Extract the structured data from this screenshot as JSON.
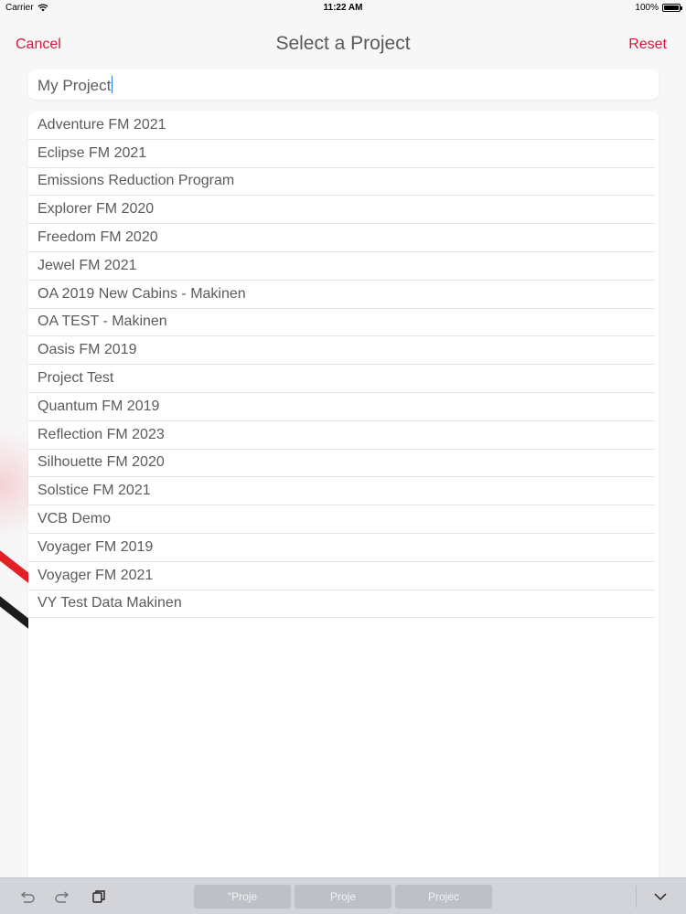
{
  "status_bar": {
    "carrier": "Carrier",
    "time": "11:22 AM",
    "battery": "100%"
  },
  "nav": {
    "cancel_label": "Cancel",
    "title": "Select a Project",
    "reset_label": "Reset"
  },
  "search": {
    "value": "My Project"
  },
  "projects": [
    "Adventure FM 2021",
    "Eclipse FM 2021",
    "Emissions Reduction Program",
    "Explorer FM 2020",
    "Freedom FM 2020",
    "Jewel FM 2021",
    "OA 2019 New Cabins - Makinen",
    "OA TEST - Makinen",
    "Oasis FM 2019",
    "Project Test",
    "Quantum FM 2019",
    "Reflection FM 2023",
    "Silhouette FM 2020",
    "Solstice FM 2021",
    "VCB Demo",
    "Voyager FM 2019",
    "Voyager FM 2021",
    "VY Test Data Makinen"
  ],
  "keyboard_bar": {
    "suggestions": [
      "\"Proje",
      "Proje",
      "Projec"
    ]
  },
  "colors": {
    "accent": "#d4173b",
    "title": "#58595b",
    "list_text": "#5a5b5d"
  }
}
